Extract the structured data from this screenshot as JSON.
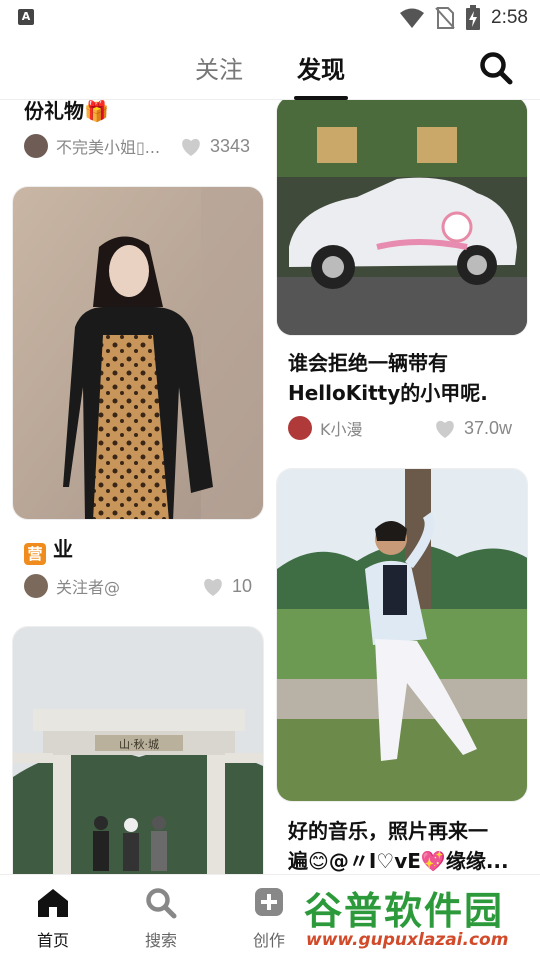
{
  "status": {
    "time": "2:58",
    "app_badge": "A"
  },
  "tabs": {
    "follow": "关注",
    "discover": "发现"
  },
  "feed": {
    "left": [
      {
        "title": "份礼物🎁",
        "author": "不完美小姐\u0000...",
        "likes": "3343"
      },
      {
        "title": "业",
        "title_badge": "营",
        "author": "关注者@",
        "likes": "10"
      },
      {
        "title": "",
        "author": "",
        "likes": ""
      }
    ],
    "right": [
      {
        "title": "谁会拒绝一辆带有HelloKitty的小甲呢.",
        "author": "K小漫",
        "likes": "37.0w"
      },
      {
        "title": "好的音乐，照片再来一遍😊@〃I♡vE💖缘缘...",
        "author": "",
        "likes": ""
      }
    ]
  },
  "card_texts": {
    "left0_author": "不完美小姐▯...",
    "right1_line1": "好的音乐，照片再来一",
    "right1_line2": "遍😊@〃I♡vE💖缘缘..."
  },
  "gate_sign": "山·秋·城",
  "nav": [
    {
      "label": "首页",
      "icon": "home-icon"
    },
    {
      "label": "搜索",
      "icon": "search-icon"
    },
    {
      "label": "创作",
      "icon": "plus-icon"
    }
  ],
  "watermark": {
    "main": "谷普软件园",
    "url": "www.gupuxlazai.com"
  },
  "colors": {
    "accent": "#111111",
    "muted": "#888888",
    "watermark_green": "#2c9a3a",
    "watermark_red": "#d14a2a"
  }
}
